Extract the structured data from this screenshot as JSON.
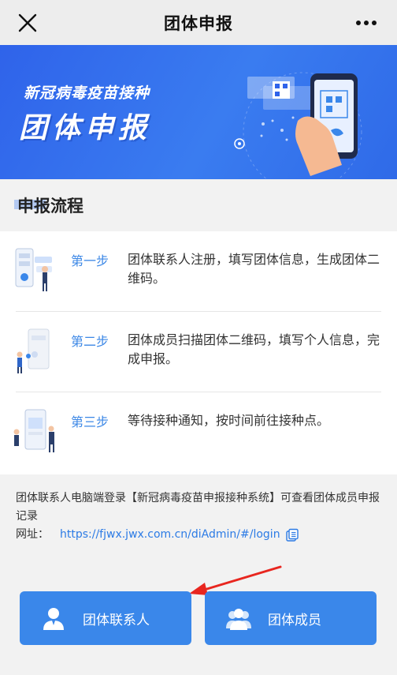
{
  "navbar": {
    "title": "团体申报",
    "close_icon": "close-icon",
    "more_icon": "more-dots-icon"
  },
  "banner": {
    "line1": "新冠病毒疫苗接种",
    "line2": "团体申报"
  },
  "section": {
    "title": "申报流程"
  },
  "steps": [
    {
      "label": "第一步",
      "desc": "团体联系人注册，填写团体信息，生成团体二维码。"
    },
    {
      "label": "第二步",
      "desc": "团体成员扫描团体二维码，填写个人信息，完成申报。"
    },
    {
      "label": "第三步",
      "desc": "等待接种通知，按时间前往接种点。"
    }
  ],
  "note": {
    "text": "团体联系人电脑端登录【新冠病毒疫苗申报接种系统】可查看团体成员申报记录",
    "url_label": "网址：",
    "url": "https://fjwx.jwx.com.cn/diAdmin/#/login"
  },
  "buttons": {
    "contact": "团体联系人",
    "members": "团体成员"
  },
  "colors": {
    "accent": "#3a87ea",
    "link": "#2c7be5",
    "step_label": "#3b87e6",
    "banner": "#2f63ea",
    "arrow": "#e8261f"
  }
}
